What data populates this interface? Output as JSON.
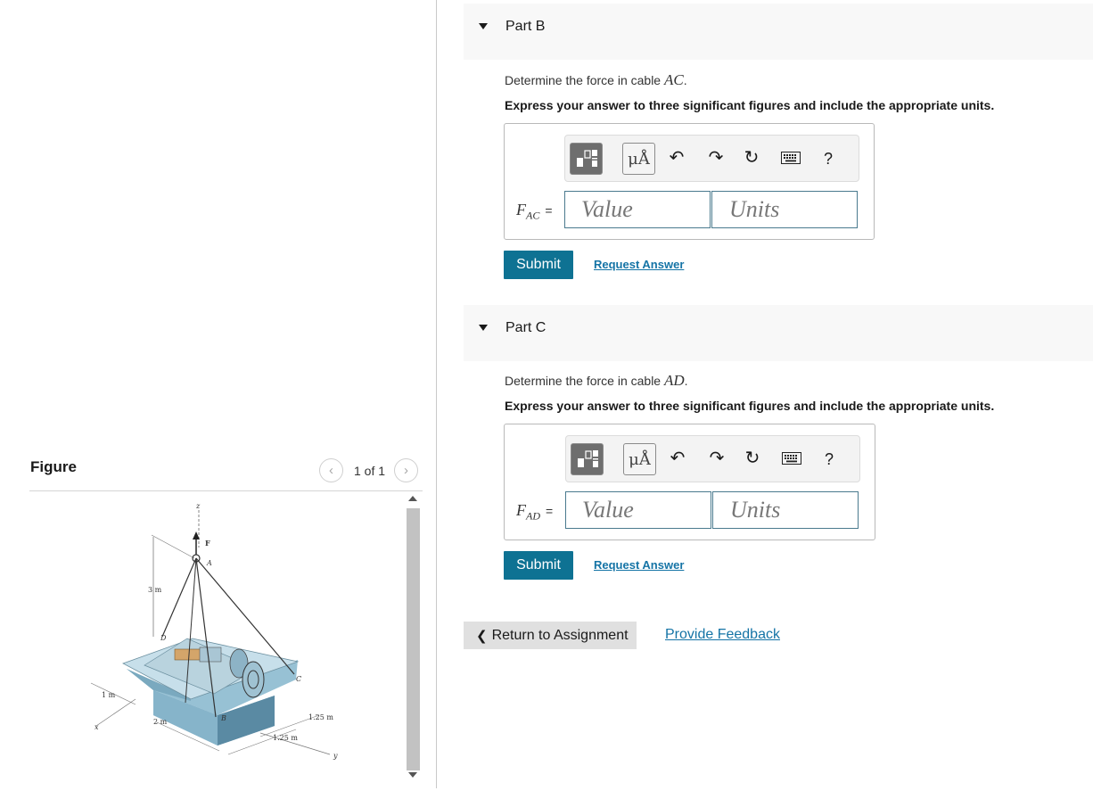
{
  "figure": {
    "title": "Figure",
    "pager": {
      "prev_icon": "chevron-left-icon",
      "next_icon": "chevron-right-icon",
      "text": "1 of 1"
    },
    "labels": {
      "z": "z",
      "F": "F",
      "A": "A",
      "D": "D",
      "B": "B",
      "C": "C",
      "x": "x",
      "y": "y",
      "height": "3 m",
      "dim_1m": "1 m",
      "dim_2m": "2 m",
      "dim_125a": "1.25 m",
      "dim_125b": "1.25 m"
    }
  },
  "parts": [
    {
      "title": "Part B",
      "prompt_prefix": "Determine the force in cable",
      "prompt_var": "AC",
      "prompt_suffix": ".",
      "instruction": "Express your answer to three significant figures and include the appropriate units.",
      "units_btn_label": "μÅ",
      "label_symbol": "F",
      "label_sub": "AC",
      "label_eq": "=",
      "value_placeholder": "Value",
      "units_placeholder": "Units",
      "submit_label": "Submit",
      "request_label": "Request Answer"
    },
    {
      "title": "Part C",
      "prompt_prefix": "Determine the force in cable",
      "prompt_var": "AD",
      "prompt_suffix": ".",
      "instruction": "Express your answer to three significant figures and include the appropriate units.",
      "units_btn_label": "μÅ",
      "label_symbol": "F",
      "label_sub": "AD",
      "label_eq": "=",
      "value_placeholder": "Value",
      "units_placeholder": "Units",
      "submit_label": "Submit",
      "request_label": "Request Answer"
    }
  ],
  "toolbar": {
    "help_label": "?",
    "icons": [
      "templates-icon",
      "units-icon",
      "undo-icon",
      "redo-icon",
      "reset-icon",
      "keyboard-icon",
      "help-icon"
    ]
  },
  "footer": {
    "return_label": "Return to Assignment",
    "feedback_label": "Provide Feedback"
  },
  "colors": {
    "submit": "#0e7293",
    "link": "#1574a6",
    "header_bg": "#f8f8f8"
  }
}
